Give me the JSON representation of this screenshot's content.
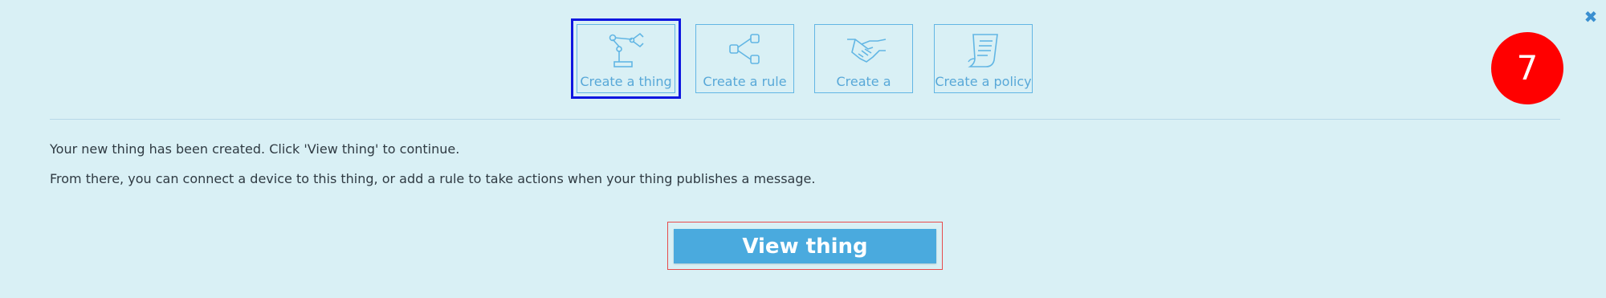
{
  "dialog": {
    "close_icon": "close-icon",
    "step_number": "7"
  },
  "tiles": [
    {
      "label": "Create a thing",
      "icon": "robot-arm-icon",
      "active": true
    },
    {
      "label": "Create a rule",
      "icon": "branch-rule-icon",
      "active": false
    },
    {
      "label": "Create a",
      "icon": "handshake-icon",
      "active": false
    },
    {
      "label": "Create a policy",
      "icon": "policy-document-icon",
      "active": false
    }
  ],
  "messages": {
    "line1": "Your new thing has been created. Click 'View thing' to continue.",
    "line2": "From there, you can connect a device to this thing, or add a rule to take actions when your thing publishes a message."
  },
  "actions": {
    "view_thing_label": "View thing"
  },
  "colors": {
    "background": "#d9f0f5",
    "accent": "#4aaade",
    "badge": "#ff0000",
    "active_outline": "#0f17e0"
  }
}
